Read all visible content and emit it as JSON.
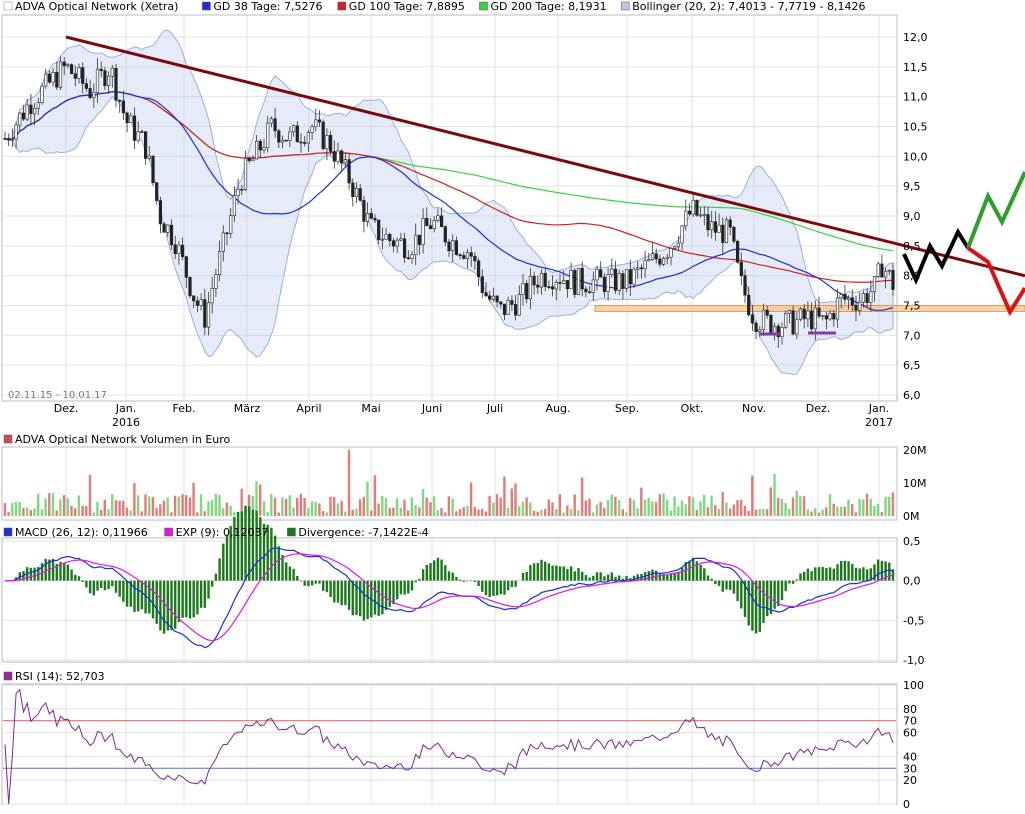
{
  "chart_data": [
    {
      "panel": "price",
      "type": "candlestick",
      "legend": [
        {
          "label": "ADVA Optical Network (Xetra)",
          "color": "#ffffff",
          "stroke": "#888888"
        },
        {
          "label": "GD 38 Tage: 7,5276",
          "color": "#1c2fd8"
        },
        {
          "label": "GD 100 Tage: 7,8895",
          "color": "#d02020"
        },
        {
          "label": "GD 200 Tage: 8,1931",
          "color": "#3bd23b"
        },
        {
          "label": "Bollinger (20, 2): 7,4013 - 7,7719 - 8,1426",
          "color": "#b7c6ee"
        }
      ],
      "date_range_label": "02.11.15 - 10.01.17",
      "x_labels": [
        "Dez.",
        "Jan.",
        "Feb.",
        "März",
        "April",
        "Mai",
        "Juni",
        "Juli",
        "Aug.",
        "Sep.",
        "Okt.",
        "Nov.",
        "Dez.",
        "Jan."
      ],
      "x_year_labels": [
        {
          "at": "Jan.",
          "text": "2016",
          "index": 1
        },
        {
          "at": "Jan.",
          "text": "2017",
          "index": 13
        }
      ],
      "ylim": [
        6.0,
        12.4
      ],
      "y_ticks": [
        "12,0",
        "11,5",
        "11,0",
        "10,5",
        "10,0",
        "9,5",
        "9,0",
        "8,5",
        "8,0",
        "7,5",
        "7,0",
        "6,5",
        "6,0"
      ],
      "y_tick_values": [
        12.0,
        11.5,
        11.0,
        10.5,
        10.0,
        9.5,
        9.0,
        8.5,
        8.0,
        7.5,
        7.0,
        6.5,
        6.0
      ],
      "series_close": [
        {
          "month": "2015-11",
          "close": 10.3
        },
        {
          "month": "2015-12",
          "close": 11.4
        },
        {
          "month": "2016-01",
          "close": 10.5
        },
        {
          "month": "2016-02",
          "close": 7.4
        },
        {
          "month": "2016-03",
          "close": 9.8
        },
        {
          "month": "2016-04",
          "close": 10.4
        },
        {
          "month": "2016-05",
          "close": 8.6
        },
        {
          "month": "2016-06",
          "close": 8.9
        },
        {
          "month": "2016-07",
          "close": 7.3
        },
        {
          "month": "2016-08",
          "close": 7.9
        },
        {
          "month": "2016-09",
          "close": 8.2
        },
        {
          "month": "2016-10",
          "close": 8.8
        },
        {
          "month": "2016-11",
          "close": 7.3
        },
        {
          "month": "2016-12",
          "close": 7.7
        },
        {
          "month": "2017-01",
          "close": 7.8
        }
      ],
      "trendline": {
        "from": {
          "month": "2015-12",
          "value": 12.0
        },
        "to": {
          "month": "2017-01",
          "value": 8.2
        },
        "color": "#7a0a0a"
      },
      "support_band": {
        "from": 7.4,
        "to": 7.5,
        "color": "#f5c08a"
      },
      "projections": [
        "#000000",
        "#2aa02a",
        "#e01010"
      ]
    },
    {
      "panel": "volume",
      "type": "bar",
      "title": "ADVA Optical Network Volumen in Euro",
      "y_ticks": [
        "20M",
        "10M",
        "0M"
      ],
      "y_tick_values": [
        20,
        10,
        0
      ],
      "unit": "M"
    },
    {
      "panel": "macd",
      "type": "line",
      "legend": [
        {
          "label": "MACD (26, 12): 0,11966",
          "color": "#1c2fd8"
        },
        {
          "label": "EXP (9): 0,12037",
          "color": "#e018e0"
        },
        {
          "label": "Divergence: -7,1422E-4",
          "color": "#1a7a1a"
        }
      ],
      "ylim": [
        -1.0,
        0.5
      ],
      "y_ticks": [
        "0,5",
        "0,0",
        "-0,5",
        "-1,0"
      ],
      "y_tick_values": [
        0.5,
        0.0,
        -0.5,
        -1.0
      ]
    },
    {
      "panel": "rsi",
      "type": "line",
      "legend": [
        {
          "label": "RSI (14): 52,703",
          "color": "#9a2a9a"
        }
      ],
      "ylim": [
        0,
        100
      ],
      "y_ticks": [
        "100",
        "80",
        "60",
        "40",
        "20",
        "0"
      ],
      "y_tick_values": [
        100,
        80,
        60,
        40,
        20,
        0
      ],
      "levels": [
        {
          "label": "70",
          "value": 70,
          "color": "#e05a5a"
        },
        {
          "label": "30",
          "value": 30,
          "color": "#5a6ae0"
        }
      ],
      "series_color": "#7a2a8a"
    }
  ]
}
